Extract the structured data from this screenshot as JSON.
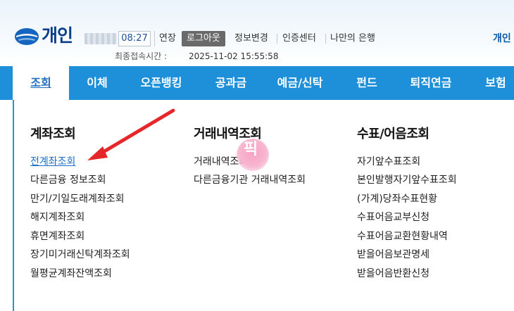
{
  "header": {
    "logo_text": "개인",
    "timer": "08:27",
    "extend_label": "연장",
    "logout_label": "로그아웃",
    "links": [
      "정보변경",
      "인증센터",
      "나만의 은행"
    ],
    "right_link": "개인",
    "last_login_label": "최종접속시간 :",
    "last_login_value": "2025-11-02 15:55:58"
  },
  "nav": {
    "active": "조회",
    "items": [
      "이체",
      "오픈뱅킹",
      "공과금",
      "예금/신탁",
      "펀드",
      "퇴직연금",
      "보험"
    ]
  },
  "menu": {
    "columns": [
      {
        "title": "계좌조회",
        "items": [
          "전계좌조회",
          "다른금융 정보조회",
          "만기/기일도래계좌조회",
          "해지계좌조회",
          "휴면계좌조회",
          "장기미거래신탁계좌조회",
          "월평균계좌잔액조회"
        ]
      },
      {
        "title": "거래내역조회",
        "items": [
          "거래내역조회",
          "다른금융기관 거래내역조회"
        ]
      },
      {
        "title": "수표/어음조회",
        "items": [
          "자기앞수표조회",
          "본인발행자기앞수표조회",
          "(가계)당좌수표현황",
          "수표어음교부신청",
          "수표어음교환현황내역",
          "받을어음보관명세",
          "받을어음반환신청"
        ]
      }
    ]
  },
  "overlay": {
    "pick_text": "픽",
    "arrow_color": "#e5262b",
    "badge_color": "#f7a3c3"
  },
  "colors": {
    "nav_bg": "#1e8fd9",
    "logo_blue": "#0b3e8a",
    "link_blue": "#1a6fc9"
  }
}
